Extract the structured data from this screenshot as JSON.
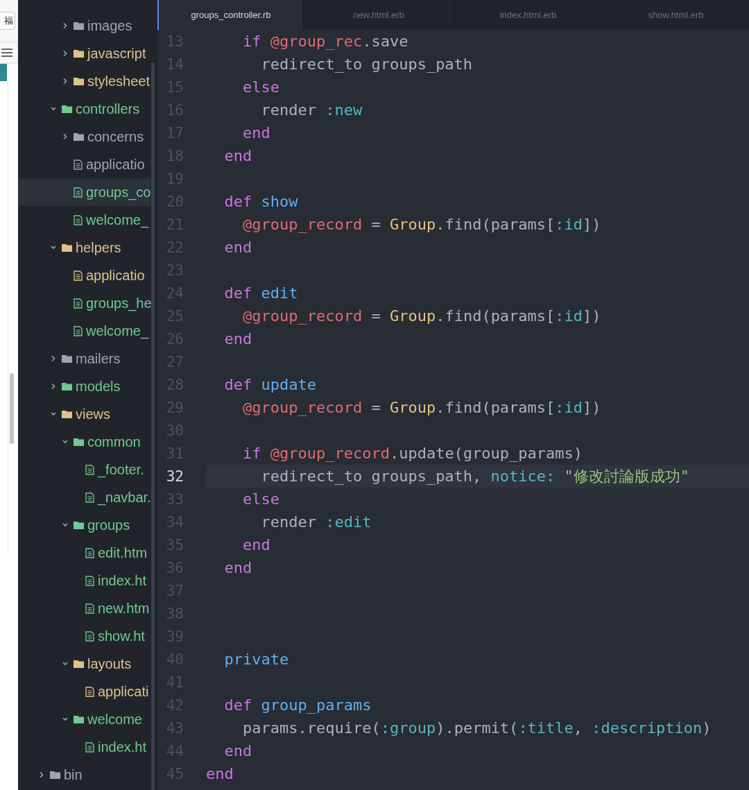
{
  "background_window": {
    "button": "福"
  },
  "tree": [
    {
      "children": [
        {
          "children": [
            {
              "label": "images",
              "kind": "folder",
              "expanded": false,
              "selected": false,
              "color": "#9da5b4"
            },
            {
              "label": "javascript",
              "kind": "folder",
              "expanded": false,
              "selected": false,
              "color": "#e2c08d"
            },
            {
              "label": "stylesheet",
              "kind": "folder",
              "expanded": false,
              "selected": false,
              "color": "#e2c08d"
            }
          ]
        },
        {
          "label": "controllers",
          "kind": "folder",
          "expanded": true,
          "selected": false,
          "color": "#73c990",
          "children": [
            {
              "label": "concerns",
              "kind": "folder",
              "expanded": false,
              "selected": false,
              "color": "#9da5b4"
            },
            {
              "label": "applicatio",
              "kind": "file",
              "selected": false,
              "color": "#9da5b4"
            },
            {
              "label": "groups_co",
              "kind": "file",
              "selected": true,
              "color": "#73c990"
            },
            {
              "label": "welcome_",
              "kind": "file",
              "selected": false,
              "color": "#73c990"
            }
          ]
        },
        {
          "label": "helpers",
          "kind": "folder",
          "expanded": true,
          "selected": false,
          "color": "#e2c08d",
          "children": [
            {
              "label": "applicatio",
              "kind": "file",
              "selected": false,
              "color": "#e2c08d"
            },
            {
              "label": "groups_he",
              "kind": "file",
              "selected": false,
              "color": "#73c990"
            },
            {
              "label": "welcome_",
              "kind": "file",
              "selected": false,
              "color": "#73c990"
            }
          ]
        },
        {
          "label": "mailers",
          "kind": "folder",
          "expanded": false,
          "selected": false,
          "color": "#9da5b4"
        },
        {
          "label": "models",
          "kind": "folder",
          "expanded": false,
          "selected": false,
          "color": "#73c990"
        },
        {
          "label": "views",
          "kind": "folder",
          "expanded": true,
          "selected": false,
          "color": "#e2c08d",
          "children": [
            {
              "label": "common",
              "kind": "folder",
              "expanded": true,
              "selected": false,
              "color": "#73c990",
              "children": [
                {
                  "label": "_footer.",
                  "kind": "file",
                  "selected": false,
                  "color": "#73c990"
                },
                {
                  "label": "_navbar.",
                  "kind": "file",
                  "selected": false,
                  "color": "#73c990"
                }
              ]
            },
            {
              "label": "groups",
              "kind": "folder",
              "expanded": true,
              "selected": false,
              "color": "#73c990",
              "children": [
                {
                  "label": "edit.htm",
                  "kind": "file",
                  "selected": false,
                  "color": "#73c990"
                },
                {
                  "label": "index.ht",
                  "kind": "file",
                  "selected": false,
                  "color": "#73c990"
                },
                {
                  "label": "new.htm",
                  "kind": "file",
                  "selected": false,
                  "color": "#73c990"
                },
                {
                  "label": "show.ht",
                  "kind": "file",
                  "selected": false,
                  "color": "#73c990"
                }
              ]
            },
            {
              "label": "layouts",
              "kind": "folder",
              "expanded": true,
              "selected": false,
              "color": "#e2c08d",
              "children": [
                {
                  "label": "applicati",
                  "kind": "file",
                  "selected": false,
                  "color": "#e2c08d"
                }
              ]
            },
            {
              "label": "welcome",
              "kind": "folder",
              "expanded": true,
              "selected": false,
              "color": "#73c990",
              "children": [
                {
                  "label": "index.ht",
                  "kind": "file",
                  "selected": false,
                  "color": "#73c990"
                }
              ]
            }
          ]
        }
      ]
    },
    {
      "label": "bin",
      "kind": "folder",
      "expanded": false,
      "selected": false,
      "color": "#9da5b4"
    }
  ],
  "tabs": [
    {
      "label": "groups_controller.rb",
      "selected": true
    },
    {
      "label": "new.html.erb",
      "selected": false
    },
    {
      "label": "index.html.erb",
      "selected": false
    },
    {
      "label": "show.html.erb",
      "selected": false
    }
  ],
  "lines": [
    {
      "number": "13",
      "current": false,
      "tokens": [
        {
          "kind": "keyword",
          "text": "    if "
        },
        {
          "kind": "ivar",
          "text": "@group_rec"
        },
        {
          "kind": "plain",
          "text": ".save"
        }
      ]
    },
    {
      "number": "14",
      "current": false,
      "tokens": [
        {
          "kind": "plain",
          "text": "      redirect_to groups_path"
        }
      ]
    },
    {
      "number": "15",
      "current": false,
      "tokens": [
        {
          "kind": "keyword",
          "text": "    else"
        }
      ]
    },
    {
      "number": "16",
      "current": false,
      "tokens": [
        {
          "kind": "plain",
          "text": "      render "
        },
        {
          "kind": "symbol",
          "text": ":new"
        }
      ]
    },
    {
      "number": "17",
      "current": false,
      "tokens": [
        {
          "kind": "keyword",
          "text": "    end"
        }
      ]
    },
    {
      "number": "18",
      "current": false,
      "tokens": [
        {
          "kind": "keyword",
          "text": "  end"
        }
      ]
    },
    {
      "number": "19",
      "current": false
    },
    {
      "number": "20",
      "current": false,
      "tokens": [
        {
          "kind": "keyword",
          "text": "  def "
        },
        {
          "kind": "function",
          "text": "show"
        }
      ]
    },
    {
      "number": "21",
      "current": false,
      "tokens": [
        {
          "kind": "ivar",
          "text": "    @group_record"
        },
        {
          "kind": "plain",
          "text": " = "
        },
        {
          "kind": "constant",
          "text": "Group"
        },
        {
          "kind": "plain",
          "text": ".find(params["
        },
        {
          "kind": "symbol",
          "text": ":id"
        },
        {
          "kind": "plain",
          "text": "])"
        }
      ]
    },
    {
      "number": "22",
      "current": false,
      "tokens": [
        {
          "kind": "keyword",
          "text": "  end"
        }
      ]
    },
    {
      "number": "23",
      "current": false
    },
    {
      "number": "24",
      "current": false,
      "tokens": [
        {
          "kind": "keyword",
          "text": "  def "
        },
        {
          "kind": "function",
          "text": "edit"
        }
      ]
    },
    {
      "number": "25",
      "current": false,
      "tokens": [
        {
          "kind": "ivar",
          "text": "    @group_record"
        },
        {
          "kind": "plain",
          "text": " = "
        },
        {
          "kind": "constant",
          "text": "Group"
        },
        {
          "kind": "plain",
          "text": ".find(params["
        },
        {
          "kind": "symbol",
          "text": ":id"
        },
        {
          "kind": "plain",
          "text": "])"
        }
      ]
    },
    {
      "number": "26",
      "current": false,
      "tokens": [
        {
          "kind": "keyword",
          "text": "  end"
        }
      ]
    },
    {
      "number": "27",
      "current": false
    },
    {
      "number": "28",
      "current": false,
      "tokens": [
        {
          "kind": "keyword",
          "text": "  def "
        },
        {
          "kind": "function",
          "text": "update"
        }
      ]
    },
    {
      "number": "29",
      "current": false,
      "tokens": [
        {
          "kind": "ivar",
          "text": "    @group_record"
        },
        {
          "kind": "plain",
          "text": " = "
        },
        {
          "kind": "constant",
          "text": "Group"
        },
        {
          "kind": "plain",
          "text": ".find(params["
        },
        {
          "kind": "symbol",
          "text": ":id"
        },
        {
          "kind": "plain",
          "text": "])"
        }
      ]
    },
    {
      "number": "30",
      "current": false
    },
    {
      "number": "31",
      "current": false,
      "tokens": [
        {
          "kind": "keyword",
          "text": "    if "
        },
        {
          "kind": "ivar",
          "text": "@group_record"
        },
        {
          "kind": "plain",
          "text": ".update(group_params)"
        }
      ]
    },
    {
      "number": "32",
      "current": true,
      "tokens": [
        {
          "kind": "plain",
          "text": "      redirect_to groups_path, "
        },
        {
          "kind": "symbol",
          "text": "notice: "
        },
        {
          "kind": "string",
          "text": "\"修改討論版成功\""
        }
      ]
    },
    {
      "number": "33",
      "current": false,
      "tokens": [
        {
          "kind": "keyword",
          "text": "    else"
        }
      ]
    },
    {
      "number": "34",
      "current": false,
      "tokens": [
        {
          "kind": "plain",
          "text": "      render "
        },
        {
          "kind": "symbol",
          "text": ":edit"
        }
      ]
    },
    {
      "number": "35",
      "current": false,
      "tokens": [
        {
          "kind": "keyword",
          "text": "    end"
        }
      ]
    },
    {
      "number": "36",
      "current": false,
      "tokens": [
        {
          "kind": "keyword",
          "text": "  end"
        }
      ]
    },
    {
      "number": "37",
      "current": false
    },
    {
      "number": "38",
      "current": false
    },
    {
      "number": "39",
      "current": false
    },
    {
      "number": "40",
      "current": false,
      "tokens": [
        {
          "kind": "function",
          "text": "  private"
        }
      ]
    },
    {
      "number": "41",
      "current": false
    },
    {
      "number": "42",
      "current": false,
      "tokens": [
        {
          "kind": "keyword",
          "text": "  def "
        },
        {
          "kind": "function",
          "text": "group_params"
        }
      ]
    },
    {
      "number": "43",
      "current": false,
      "tokens": [
        {
          "kind": "plain",
          "text": "    params.require("
        },
        {
          "kind": "symbol",
          "text": ":group"
        },
        {
          "kind": "plain",
          "text": ").permit("
        },
        {
          "kind": "symbol",
          "text": ":title"
        },
        {
          "kind": "plain",
          "text": ", "
        },
        {
          "kind": "symbol",
          "text": ":description"
        },
        {
          "kind": "plain",
          "text": ")"
        }
      ]
    },
    {
      "number": "44",
      "current": false,
      "tokens": [
        {
          "kind": "keyword",
          "text": "  end"
        }
      ]
    },
    {
      "number": "45",
      "current": false,
      "tokens": [
        {
          "kind": "keyword",
          "text": "end"
        }
      ]
    }
  ]
}
